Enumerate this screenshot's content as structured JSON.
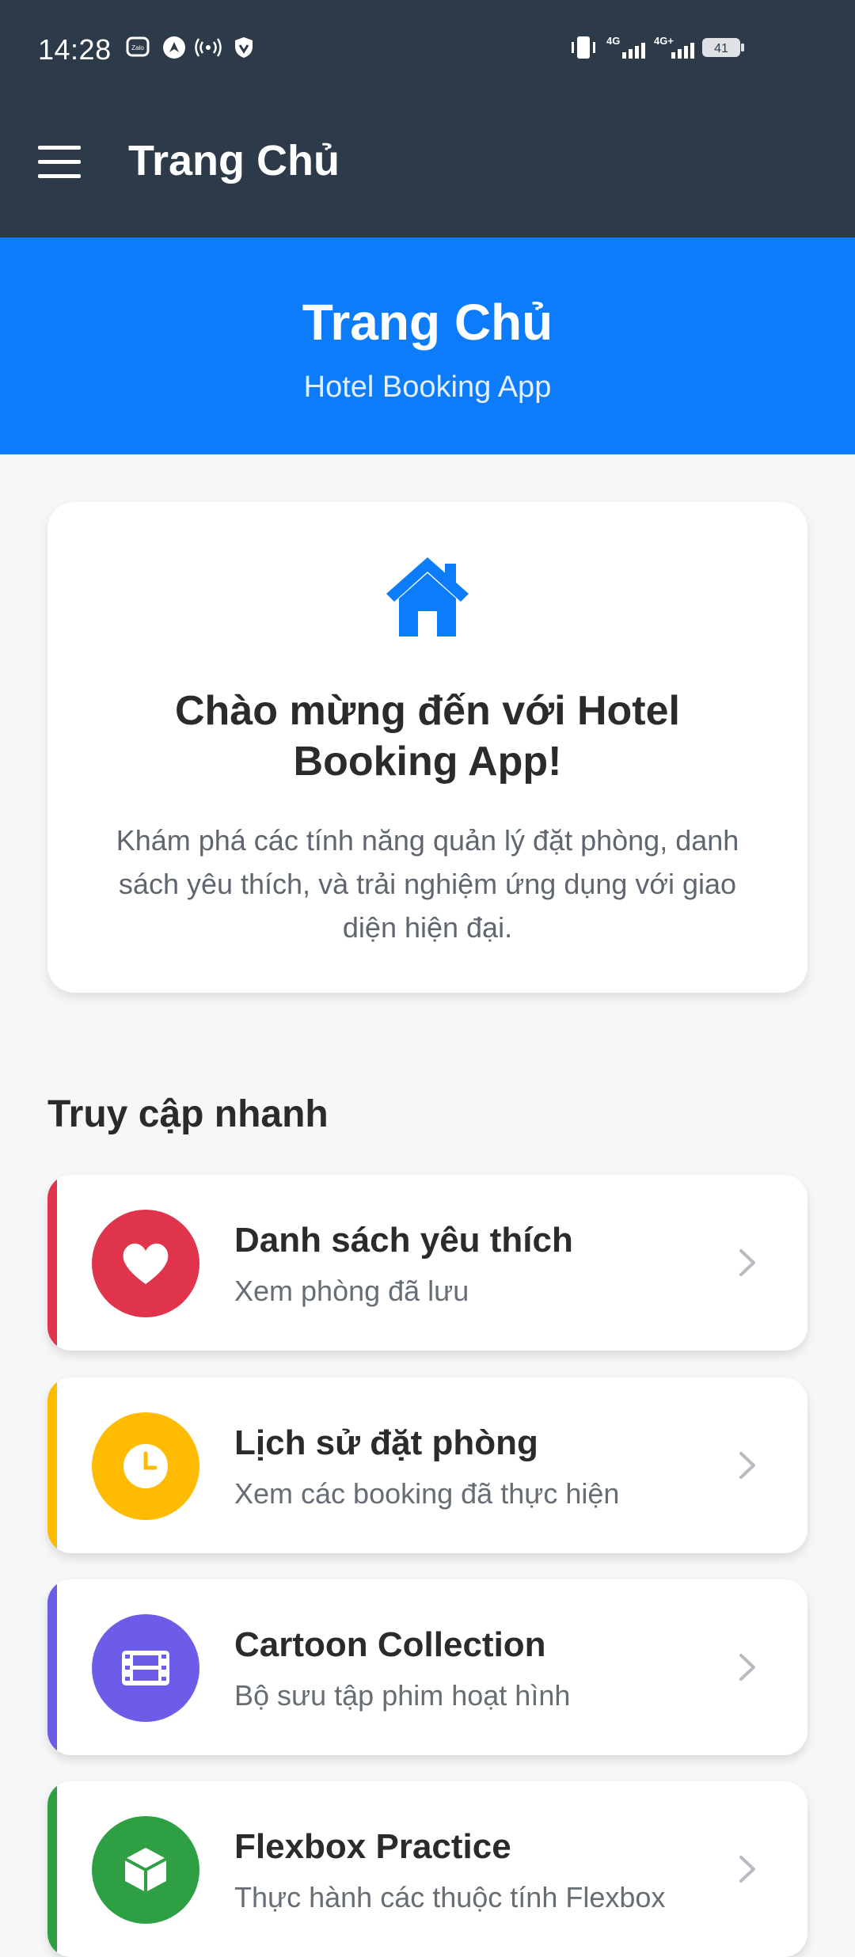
{
  "status_bar": {
    "time": "14:28",
    "icons": [
      "zalo-icon",
      "messenger-icon",
      "hotspot-icon",
      "vpn-shield-icon",
      "vibrate-icon",
      "signal-4g-icon",
      "signal-4g-plus-icon",
      "battery-icon"
    ],
    "network_1": "4G",
    "network_2": "4G+",
    "battery": "41"
  },
  "app_bar": {
    "title": "Trang Chủ",
    "menu_icon": "hamburger-menu-icon"
  },
  "hero": {
    "title": "Trang Chủ",
    "subtitle": "Hotel Booking App"
  },
  "welcome": {
    "icon": "home-icon",
    "title": "Chào mừng đến với Hotel Booking App!",
    "description": "Khám phá các tính năng quản lý đặt phòng, danh sách yêu thích, và trải nghiệm ứng dụng với giao diện hiện đại."
  },
  "quick_access": {
    "title": "Truy cập nhanh",
    "items": [
      {
        "title": "Danh sách yêu thích",
        "subtitle": "Xem phòng đã lưu",
        "icon": "heart-icon",
        "color": "#e0334c"
      },
      {
        "title": "Lịch sử đặt phòng",
        "subtitle": "Xem các booking đã thực hiện",
        "icon": "clock-icon",
        "color": "#ffbb00"
      },
      {
        "title": "Cartoon Collection",
        "subtitle": "Bộ sưu tập phim hoạt hình",
        "icon": "film-icon",
        "color": "#6c5ce7"
      },
      {
        "title": "Flexbox Practice",
        "subtitle": "Thực hành các thuộc tính Flexbox",
        "icon": "cube-icon",
        "color": "#2ea043"
      }
    ]
  },
  "colors": {
    "status_bar_bg": "#2d3a4a",
    "hero_bg": "#0d7cfb",
    "page_bg": "#f6f7f9"
  }
}
